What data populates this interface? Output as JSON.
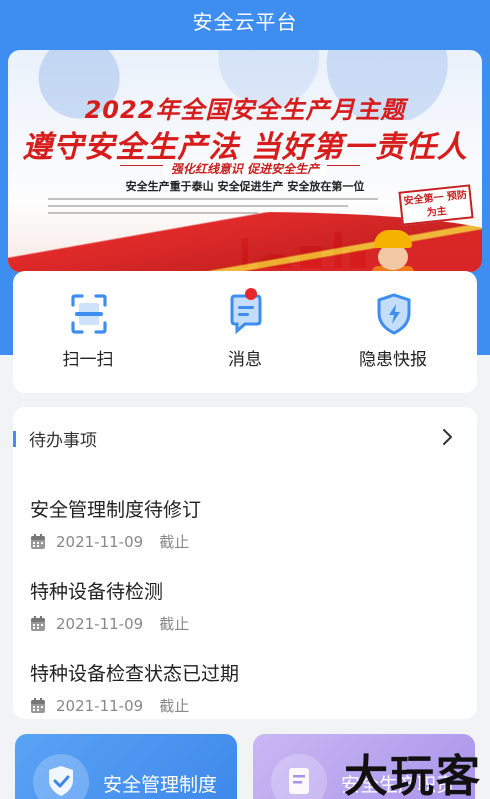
{
  "header": {
    "title": "安全云平台"
  },
  "banner": {
    "title_line1": "2022年全国安全生产月主题",
    "title_line2": "遵守安全生产法 当好第一责任人",
    "slogan": "强化红线意识 促进安全生产",
    "subtitle": "安全生产重于泰山 安全促进生产 安全放在第一位",
    "sign_text": "安全第一 预防为主"
  },
  "quick_actions": [
    {
      "label": "扫一扫",
      "icon": "scan-icon"
    },
    {
      "label": "消息",
      "icon": "message-icon",
      "has_badge": true
    },
    {
      "label": "隐患快报",
      "icon": "shield-lightning-icon"
    }
  ],
  "todo": {
    "title": "待办事项",
    "items": [
      {
        "name": "安全管理制度待修订",
        "date": "2021-11-09",
        "status": "截止"
      },
      {
        "name": "特种设备待检测",
        "date": "2021-11-09",
        "status": "截止"
      },
      {
        "name": "特种设备检查状态已过期",
        "date": "2021-11-09",
        "status": "截止"
      }
    ]
  },
  "tiles": [
    {
      "label": "安全管理制度"
    },
    {
      "label": "安全生产职责"
    }
  ],
  "watermark": "大玩客",
  "colors": {
    "primary": "#3d8ef0",
    "badge": "#e6262b",
    "banner_red": "#d71c1c"
  }
}
